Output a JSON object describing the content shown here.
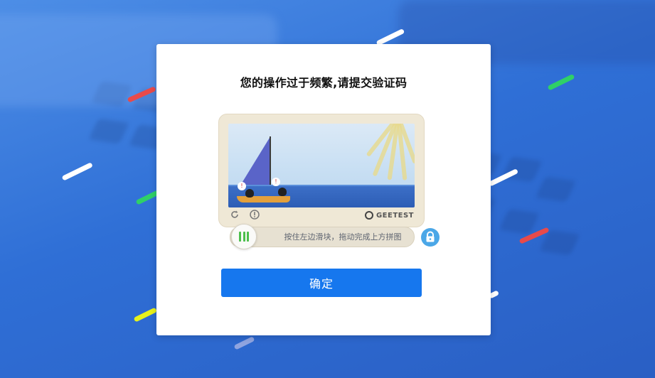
{
  "modal": {
    "title": "您的操作过于频繁,请提交验证码",
    "confirm_label": "确定"
  },
  "captcha": {
    "slider_hint": "按住左边滑块，拖动完成上方拼图",
    "brand_name": "GEETEST",
    "scene_marks": [
      "!",
      "!"
    ]
  },
  "colors": {
    "accent": "#1677ee",
    "slider_knob_bars": "#4cbf4c",
    "lock_badge": "#4ba7e7"
  },
  "icons": {
    "refresh": "refresh-icon",
    "feedback": "info-icon",
    "brand": "geetest-logo-icon",
    "lock": "lock-icon",
    "knob": "drag-handle-icon"
  }
}
